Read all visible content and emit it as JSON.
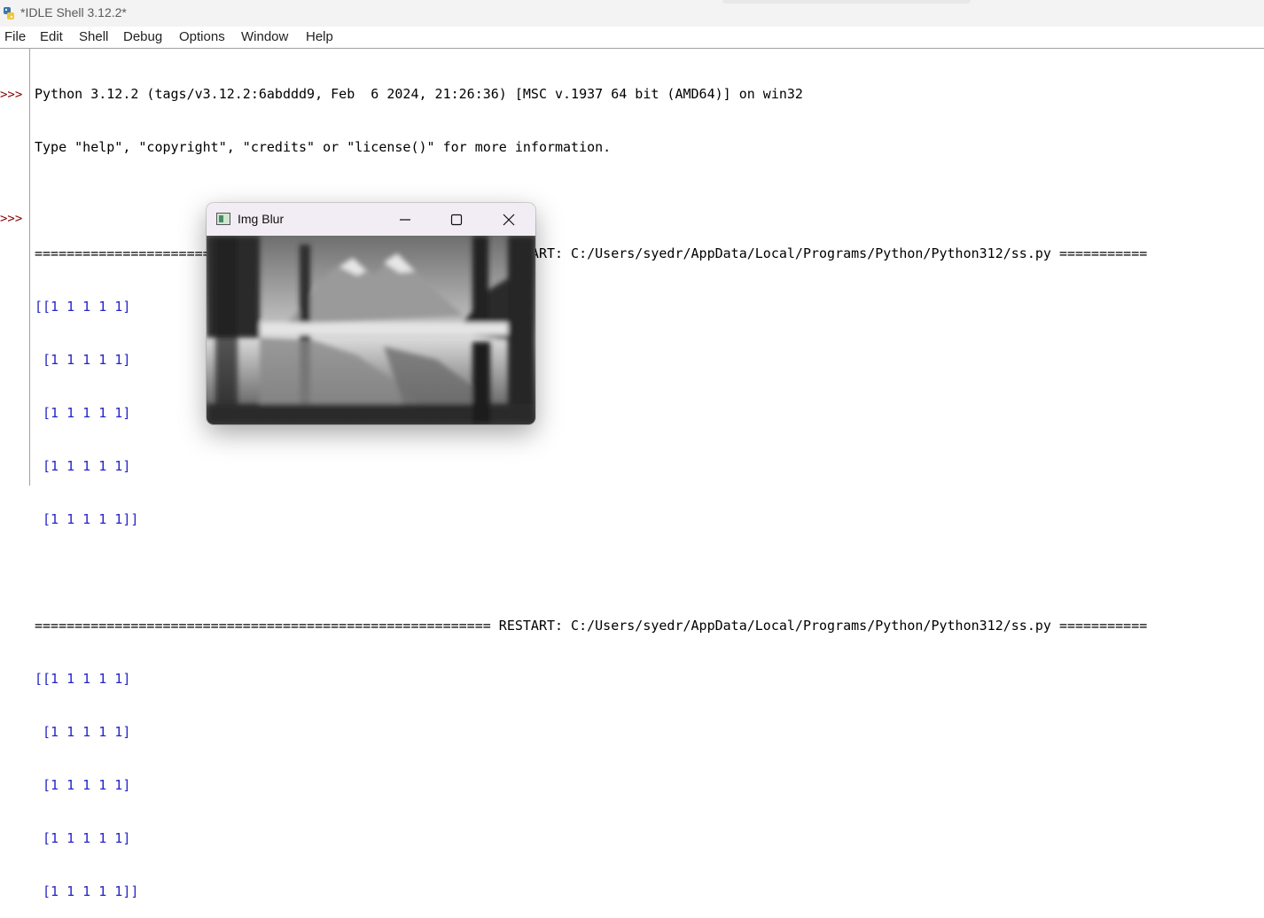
{
  "window": {
    "title": "*IDLE Shell 3.12.2*"
  },
  "menu": {
    "items": [
      "File",
      "Edit",
      "Shell",
      "Debug",
      "Options",
      "Window",
      "Help"
    ]
  },
  "shell": {
    "prompt": ">>>",
    "lines": [
      {
        "kind": "stdout",
        "text": "Python 3.12.2 (tags/v3.12.2:6abddd9, Feb  6 2024, 21:26:36) [MSC v.1937 64 bit (AMD64)] on win32"
      },
      {
        "kind": "stdout",
        "text": "Type \"help\", \"copyright\", \"credits\" or \"license()\" for more information."
      },
      {
        "kind": "blank",
        "text": ""
      },
      {
        "kind": "restart",
        "text": "========================================================= RESTART: C:/Users/syedr/AppData/Local/Programs/Python/Python312/ss.py ==========="
      },
      {
        "kind": "array",
        "text": "[[1 1 1 1 1]"
      },
      {
        "kind": "array",
        "text": " [1 1 1 1 1]"
      },
      {
        "kind": "array",
        "text": " [1 1 1 1 1]"
      },
      {
        "kind": "array",
        "text": " [1 1 1 1 1]"
      },
      {
        "kind": "array",
        "text": " [1 1 1 1 1]]"
      },
      {
        "kind": "blank",
        "text": ""
      },
      {
        "kind": "restart",
        "text": "========================================================= RESTART: C:/Users/syedr/AppData/Local/Programs/Python/Python312/ss.py ==========="
      },
      {
        "kind": "array",
        "text": "[[1 1 1 1 1]"
      },
      {
        "kind": "array",
        "text": " [1 1 1 1 1]"
      },
      {
        "kind": "array",
        "text": " [1 1 1 1 1]"
      },
      {
        "kind": "array",
        "text": " [1 1 1 1 1]"
      },
      {
        "kind": "array",
        "text": " [1 1 1 1 1]]"
      }
    ]
  },
  "popup": {
    "title": "Img Blur",
    "image_icon": "blurred-landscape-image",
    "buttons": {
      "minimize": "minimize-icon",
      "maximize": "maximize-icon",
      "close": "close-icon"
    }
  },
  "colors": {
    "prompt": "#8b0000",
    "array_output": "#2424c8",
    "stdout": "#000000"
  }
}
